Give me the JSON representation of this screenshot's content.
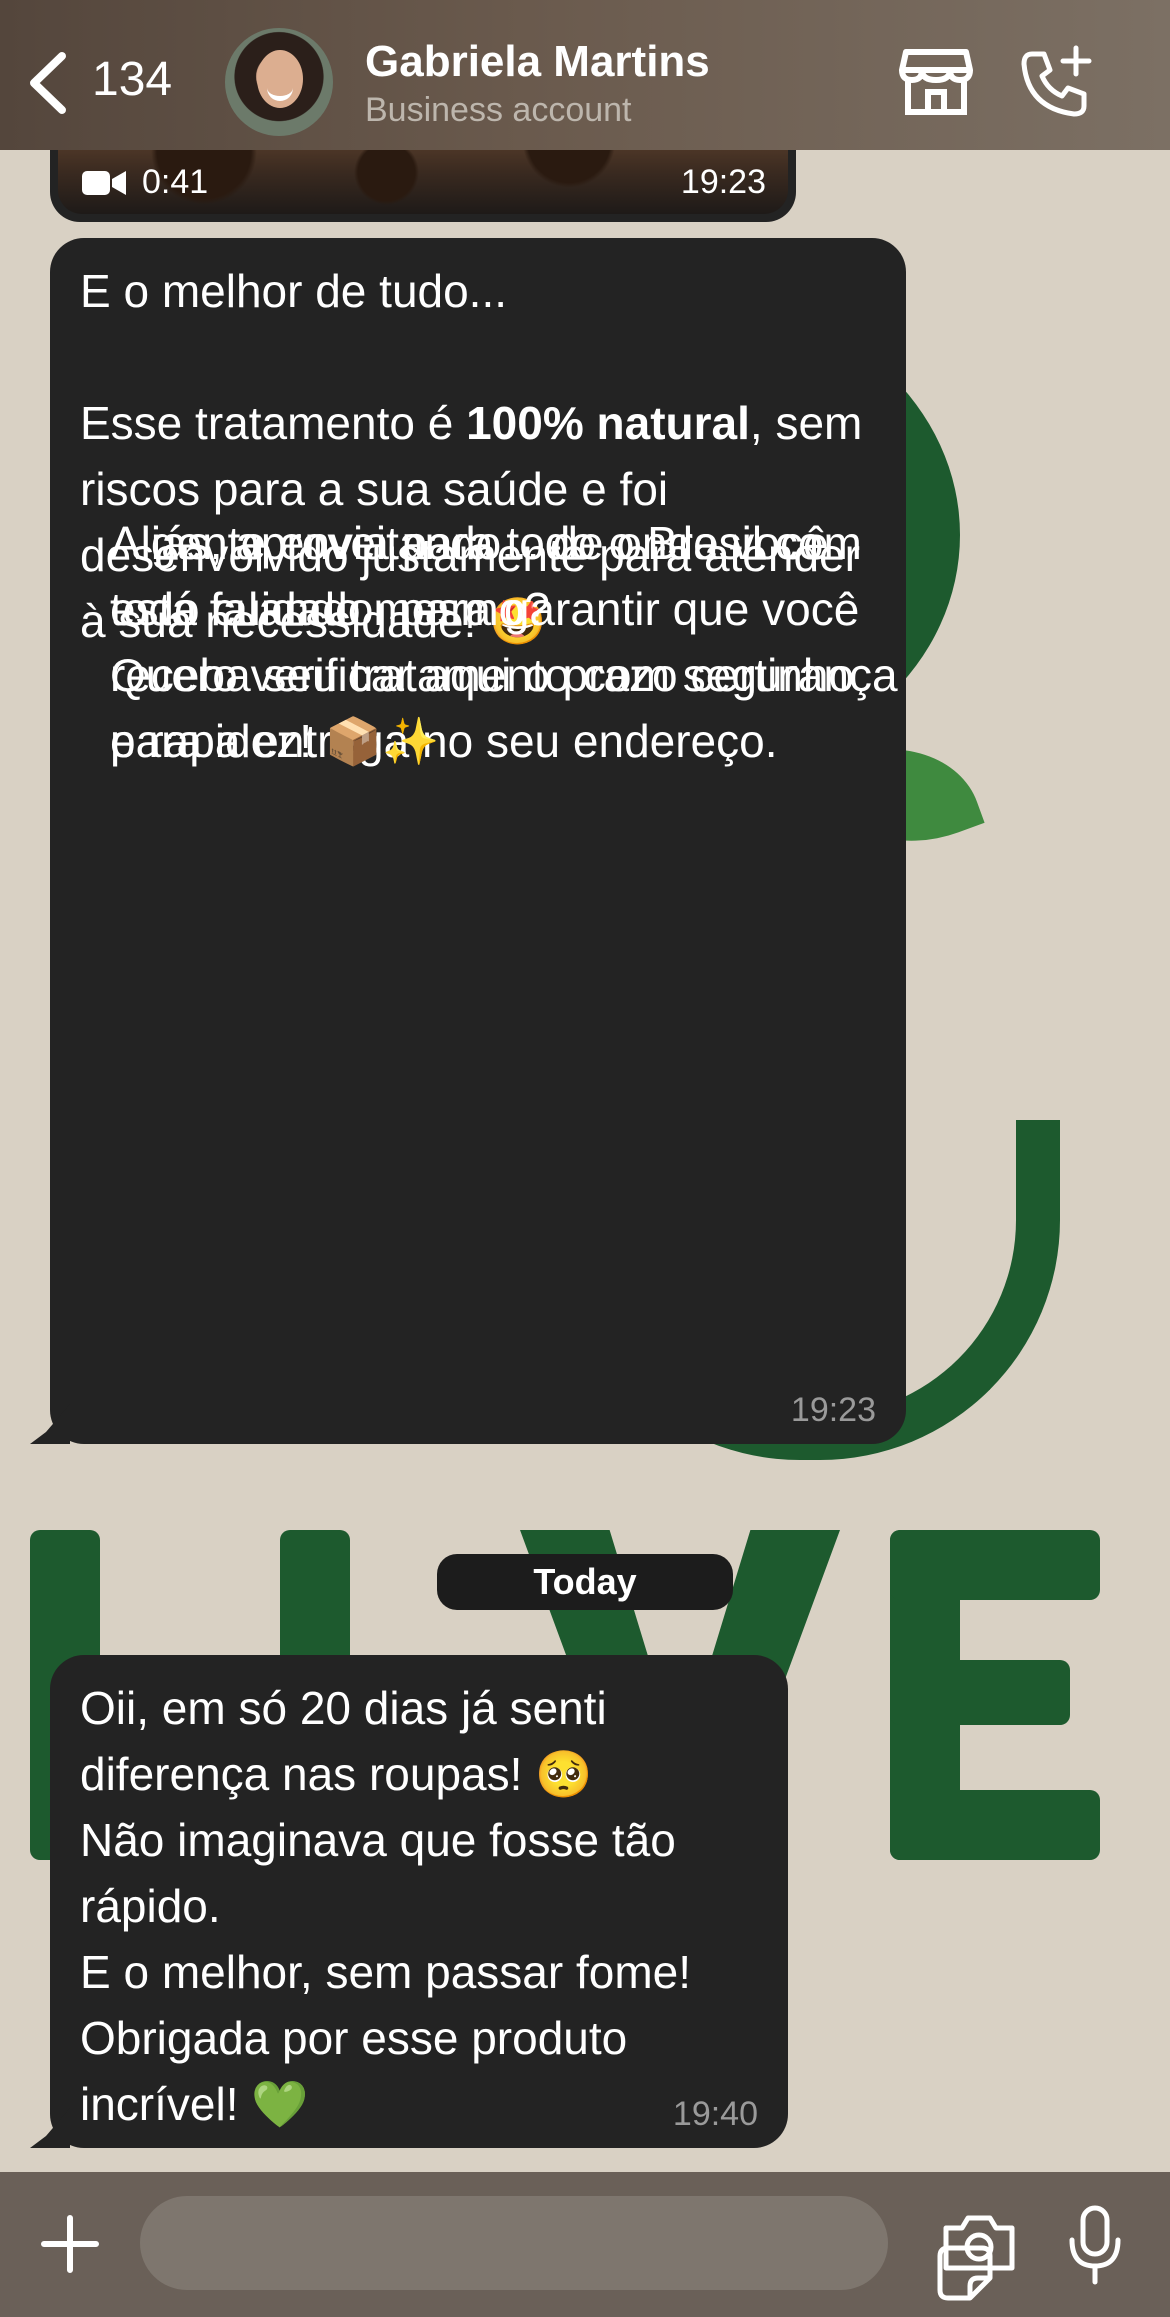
{
  "header": {
    "back_count": "134",
    "contact_name": "Gabriela Martins",
    "contact_subtitle": "Business account"
  },
  "video_message": {
    "duration": "0:41",
    "time": "19:23"
  },
  "messages": [
    {
      "first_line": "E o melhor de tudo...",
      "para1_before_bold": "Esse tratamento é ",
      "para1_bold": "100% natural",
      "para1_after_bold": ", sem riscos para a sua saúde e foi desenvolvido justamente para atender à sua necessidade! 🤩",
      "para2": "Aliás, aproveitando... de onde você está falando mesmo?\nQuero verificar aqui o prazo certinho para a entrega no seu endereço.",
      "para3": "A gente envia para todo o Brasil com todo cuidado, para garantir que você receba seu tratamento com segurança e rapidez! 📦✨",
      "time": "19:23"
    },
    {
      "text": "Oii, em só 20 dias já senti diferença nas roupas! 🥺\nNão imaginava que fosse tão rápido.\nE o melhor, sem passar fome!\nObrigada por esse produto incrível! 💚",
      "time": "19:40"
    }
  ],
  "day_divider": "Today",
  "input_bar": {
    "placeholder": ""
  }
}
